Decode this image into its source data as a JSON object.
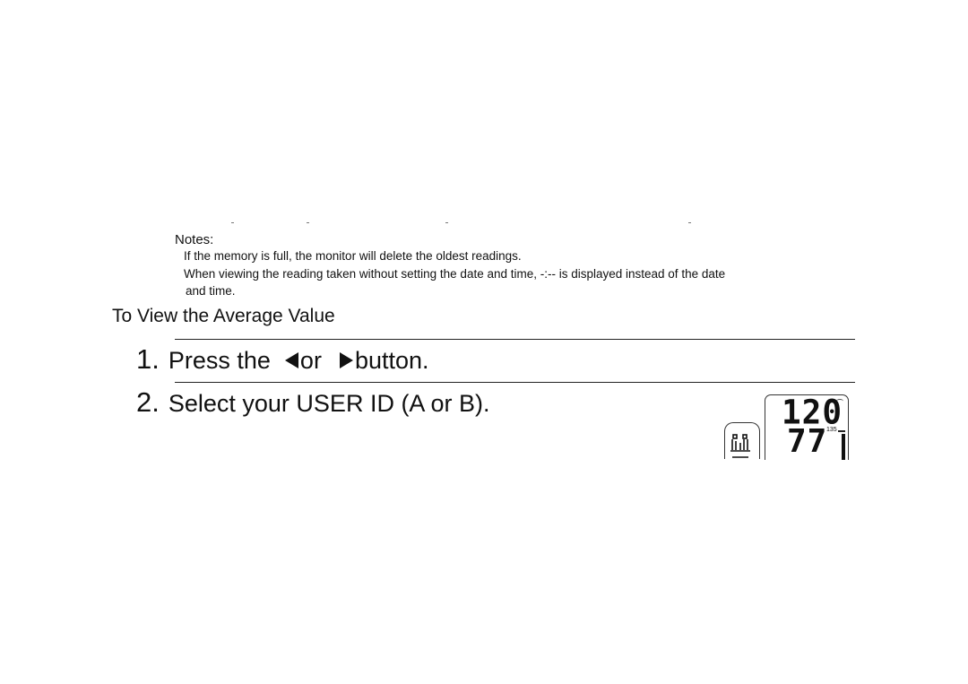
{
  "notes": {
    "title": "Notes:",
    "items": [
      "If the memory is full, the monitor will delete the oldest readings.",
      "When viewing the reading taken without setting the date and time,  -:--  is displayed instead of the date",
      "and time."
    ]
  },
  "section": {
    "title": "To View the Average Value"
  },
  "steps": [
    {
      "number": "1.",
      "text_before": "Press the",
      "text_middle": "or",
      "text_after": "button.",
      "icons": [
        "left-triangle-icon",
        "right-triangle-icon"
      ]
    },
    {
      "number": "2.",
      "text": "Select your USER ID (A or B)."
    }
  ],
  "display": {
    "systolic": "120",
    "diastolic": "77",
    "scale_label": "135",
    "icon": "average-bars-icon"
  }
}
